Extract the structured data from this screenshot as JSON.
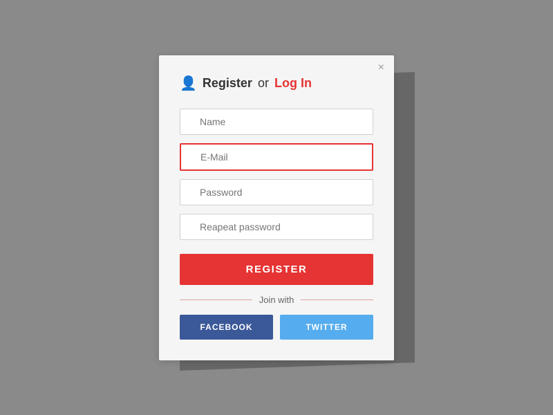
{
  "modal": {
    "title": {
      "register_label": "Register",
      "or_label": "or",
      "login_label": "Log In"
    },
    "close_label": "×",
    "fields": {
      "name": {
        "placeholder": "Name"
      },
      "email": {
        "placeholder": "E-Mail"
      },
      "password": {
        "placeholder": "Password"
      },
      "repeat_password": {
        "placeholder": "Reapeat password"
      }
    },
    "register_button": "REGISTER",
    "join_with_label": "Join with",
    "facebook_button": "FACEBOOK",
    "twitter_button": "TWITTER"
  }
}
